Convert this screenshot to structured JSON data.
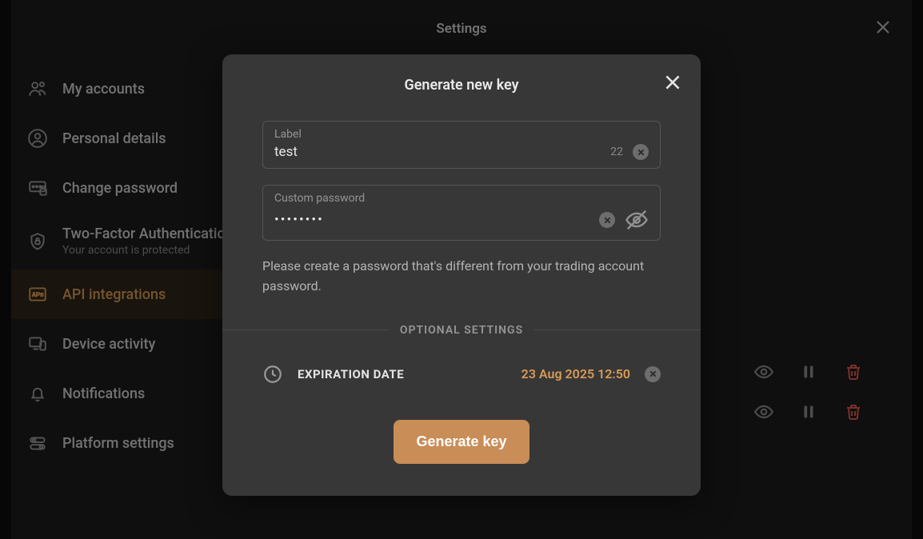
{
  "settings": {
    "title": "Settings"
  },
  "sidebar": {
    "items": [
      {
        "label": "My accounts",
        "sublabel": ""
      },
      {
        "label": "Personal details",
        "sublabel": ""
      },
      {
        "label": "Change password",
        "sublabel": ""
      },
      {
        "label": "Two-Factor Authentication",
        "sublabel": "Your account is protected"
      },
      {
        "label": "API integrations",
        "sublabel": ""
      },
      {
        "label": "Device activity",
        "sublabel": ""
      },
      {
        "label": "Notifications",
        "sublabel": ""
      },
      {
        "label": "Platform settings",
        "sublabel": ""
      }
    ]
  },
  "dialog": {
    "title": "Generate new key",
    "label_field": {
      "label": "Label",
      "value": "test",
      "counter": "22"
    },
    "password_field": {
      "label": "Custom password",
      "value": "••••••••"
    },
    "helper": "Please create a password that's different from your trading account password.",
    "divider": "OPTIONAL SETTINGS",
    "expiration_label": "EXPIRATION DATE",
    "expiration_value": "23 Aug 2025 12:50",
    "generate_button": "Generate key"
  }
}
